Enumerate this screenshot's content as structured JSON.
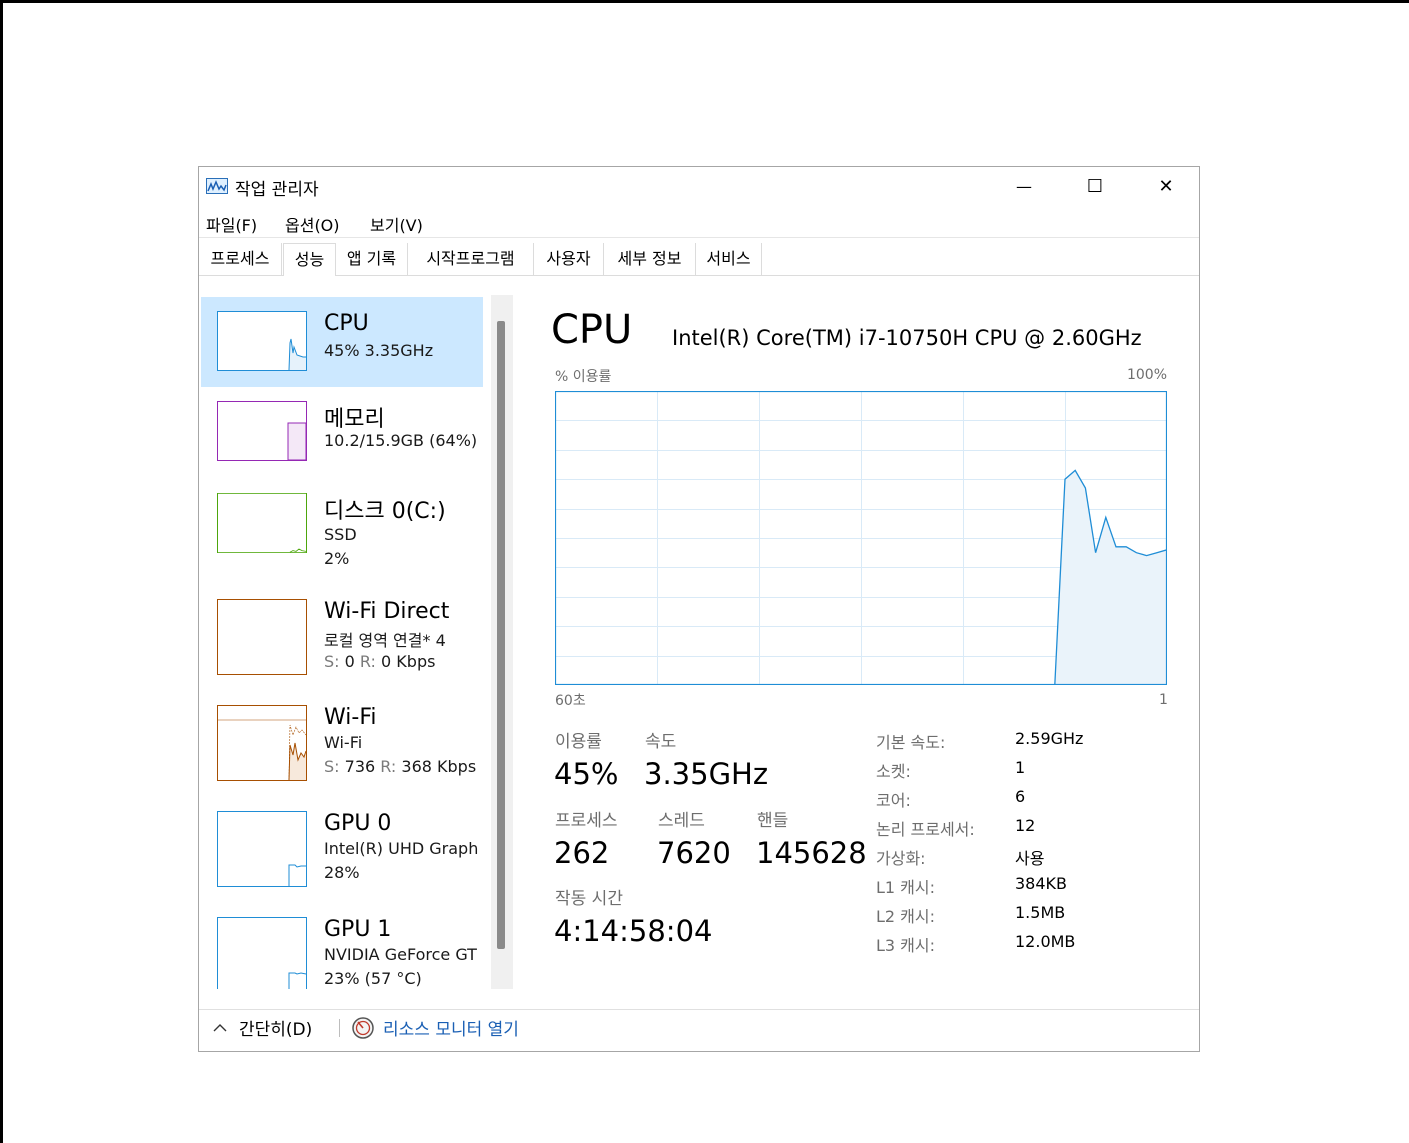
{
  "window": {
    "title": "작업 관리자",
    "minimize": "—",
    "maximize": "☐",
    "close": "✕"
  },
  "menu": [
    "파일(F)",
    "옵션(O)",
    "보기(V)"
  ],
  "tabs": [
    "프로세스",
    "성능",
    "앱 기록",
    "시작프로그램",
    "사용자",
    "세부 정보",
    "서비스"
  ],
  "active_tab": "성능",
  "sidebar": {
    "items": [
      {
        "title": "CPU",
        "lines": [
          {
            "text": "45% 3.35GHz"
          }
        ],
        "color": "#1f8dd6",
        "selected": true
      },
      {
        "title": "메모리",
        "lines": [
          {
            "text": "10.2/15.9GB (64%)"
          }
        ],
        "color": "#9528b4"
      },
      {
        "title": "디스크 0(C:)",
        "lines": [
          {
            "text": "SSD"
          },
          {
            "text": "2%"
          }
        ],
        "color": "#4da60c"
      },
      {
        "title": "Wi-Fi Direct",
        "lines": [
          {
            "text": "로컬 영역 연결* 4"
          },
          {
            "s": "S:",
            "sv": "0",
            "r": "R:",
            "rv": "0 Kbps"
          }
        ],
        "color": "#a74f01"
      },
      {
        "title": "Wi-Fi",
        "lines": [
          {
            "text": "Wi-Fi"
          },
          {
            "s": "S:",
            "sv": "736",
            "r": "R:",
            "rv": "368 Kbps"
          }
        ],
        "color": "#a74f01"
      },
      {
        "title": "GPU 0",
        "lines": [
          {
            "text": "Intel(R) UHD Graph"
          },
          {
            "text": "28%"
          }
        ],
        "color": "#1f8dd6"
      },
      {
        "title": "GPU 1",
        "lines": [
          {
            "text": "NVIDIA GeForce GT"
          },
          {
            "text": "23% (57 °C)"
          }
        ],
        "color": "#1f8dd6"
      }
    ]
  },
  "main": {
    "title": "CPU",
    "model": "Intel(R) Core(TM) i7-10750H CPU @ 2.60GHz",
    "graph": {
      "y_label": "% 이용률",
      "y_max_label": "100%",
      "x_left_label": "60초",
      "x_right_label": "1",
      "ylim": [
        0,
        100
      ],
      "x_range_seconds": [
        60,
        0
      ],
      "series": [
        0,
        0,
        0,
        0,
        0,
        0,
        0,
        0,
        0,
        0,
        0,
        0,
        0,
        0,
        0,
        0,
        0,
        0,
        0,
        0,
        0,
        0,
        0,
        0,
        0,
        0,
        0,
        0,
        0,
        0,
        0,
        0,
        0,
        0,
        0,
        0,
        0,
        0,
        0,
        0,
        0,
        0,
        0,
        0,
        0,
        0,
        0,
        0,
        0,
        0,
        70,
        73,
        67,
        45,
        57,
        47,
        47,
        45,
        44,
        45,
        46
      ]
    },
    "stats": {
      "usage_label": "이용률",
      "usage_value": "45%",
      "speed_label": "속도",
      "speed_value": "3.35GHz",
      "process_label": "프로세스",
      "process_value": "262",
      "thread_label": "스레드",
      "thread_value": "7620",
      "handle_label": "핸들",
      "handle_value": "145628",
      "uptime_label": "작동 시간",
      "uptime_value": "4:14:58:04"
    },
    "specs": [
      {
        "label": "기본 속도:",
        "value": "2.59GHz"
      },
      {
        "label": "소켓:",
        "value": "1"
      },
      {
        "label": "코어:",
        "value": "6"
      },
      {
        "label": "논리 프로세서:",
        "value": "12"
      },
      {
        "label": "가상화:",
        "value": "사용"
      },
      {
        "label": "L1 캐시:",
        "value": "384KB"
      },
      {
        "label": "L2 캐시:",
        "value": "1.5MB"
      },
      {
        "label": "L3 캐시:",
        "value": "12.0MB"
      }
    ]
  },
  "footer": {
    "fewer_details": "간단히(D)",
    "resource_monitor": "리소스 모니터 열기"
  }
}
